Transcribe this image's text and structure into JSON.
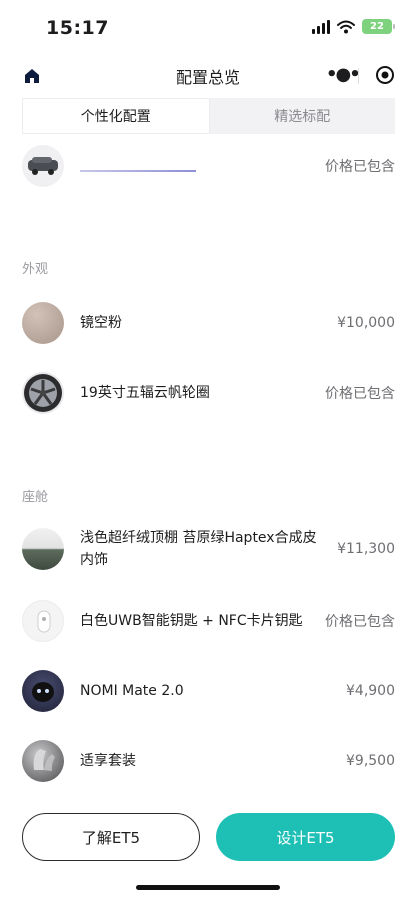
{
  "status_bar": {
    "time": "15:17",
    "battery": "22"
  },
  "nav": {
    "title": "配置总览"
  },
  "tabs": [
    {
      "label": "个性化配置",
      "active": true
    },
    {
      "label": "精选标配",
      "active": false
    }
  ],
  "top_item": {
    "price": "价格已包含"
  },
  "sections": {
    "exterior": {
      "title": "外观",
      "items": [
        {
          "label": "镜空粉",
          "price": "¥10,000"
        },
        {
          "label": "19英寸五辐云帆轮圈",
          "price": "价格已包含"
        }
      ]
    },
    "cabin": {
      "title": "座舱",
      "items": [
        {
          "label": "浅色超纤绒顶棚 苔原绿Haptex合成皮内饰",
          "price": "¥11,300"
        },
        {
          "label": "白色UWB智能钥匙 + NFC卡片钥匙",
          "price": "价格已包含"
        },
        {
          "label": "NOMI Mate 2.0",
          "price": "¥4,900"
        },
        {
          "label": "适享套装",
          "price": "¥9,500"
        }
      ]
    }
  },
  "bottom": {
    "learn_label": "了解ET5",
    "design_label": "设计ET5"
  },
  "colors": {
    "accent": "#1ec0b6",
    "swatch_pink": "#b9a79c"
  }
}
